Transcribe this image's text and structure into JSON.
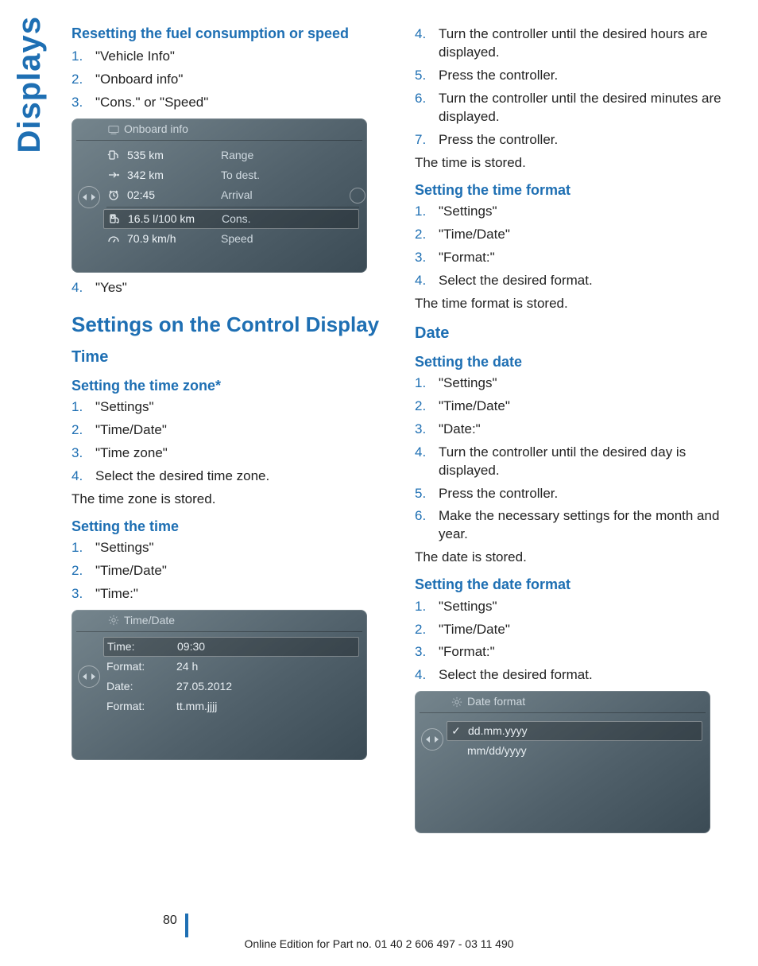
{
  "sideLabel": "Displays",
  "left": {
    "h_reset": "Resetting the fuel consumption or speed",
    "reset_steps": [
      "\"Vehicle Info\"",
      "\"Onboard info\"",
      "\"Cons.\" or \"Speed\""
    ],
    "reset_step4": "\"Yes\"",
    "onboard": {
      "title": "Onboard info",
      "rows": [
        {
          "icon": "fuel-range",
          "value": "535 km",
          "label": "Range"
        },
        {
          "icon": "to-dest",
          "value": "342 km",
          "label": "To dest."
        },
        {
          "icon": "clock",
          "value": "02:45",
          "label": "Arrival"
        },
        {
          "icon": "pump",
          "value": "16.5 l/100 km",
          "label": "Cons.",
          "selected": true
        },
        {
          "icon": "speed",
          "value": "70.9 km/h",
          "label": "Speed"
        }
      ]
    },
    "h_settings": "Settings on the Control Display",
    "h_time": "Time",
    "h_tz": "Setting the time zone*",
    "tz_steps": [
      "\"Settings\"",
      "\"Time/Date\"",
      "\"Time zone\"",
      "Select the desired time zone."
    ],
    "tz_stored": "The time zone is stored.",
    "h_settime": "Setting the time",
    "settime_steps": [
      "\"Settings\"",
      "\"Time/Date\"",
      "\"Time:\""
    ],
    "timedate": {
      "title": "Time/Date",
      "rows": [
        {
          "label": "Time:",
          "value": "09:30",
          "selected": true
        },
        {
          "label": "Format:",
          "value": "24 h"
        },
        {
          "label": "Date:",
          "value": "27.05.2012"
        },
        {
          "label": "Format:",
          "value": "tt.mm.jjjj"
        }
      ]
    }
  },
  "right": {
    "cont_steps": [
      {
        "n": "4.",
        "t": "Turn the controller until the desired hours are displayed."
      },
      {
        "n": "5.",
        "t": "Press the controller."
      },
      {
        "n": "6.",
        "t": "Turn the controller until the desired minutes are displayed."
      },
      {
        "n": "7.",
        "t": "Press the controller."
      }
    ],
    "time_stored": "The time is stored.",
    "h_tf": "Setting the time format",
    "tf_steps": [
      "\"Settings\"",
      "\"Time/Date\"",
      "\"Format:\"",
      "Select the desired format."
    ],
    "tf_stored": "The time format is stored.",
    "h_date": "Date",
    "h_sd": "Setting the date",
    "sd_steps": [
      "\"Settings\"",
      "\"Time/Date\"",
      "\"Date:\"",
      "Turn the controller until the desired day is displayed.",
      "Press the controller.",
      "Make the necessary settings for the month and year."
    ],
    "date_stored": "The date is stored.",
    "h_df": "Setting the date format",
    "df_steps": [
      "\"Settings\"",
      "\"Time/Date\"",
      "\"Format:\"",
      "Select the desired format."
    ],
    "dateformat": {
      "title": "Date format",
      "rows": [
        {
          "check": true,
          "label": "dd.mm.yyyy",
          "selected": true
        },
        {
          "check": false,
          "label": "mm/dd/yyyy"
        }
      ]
    }
  },
  "pageNumber": "80",
  "footer": "Online Edition for Part no. 01 40 2 606 497 - 03 11 490"
}
